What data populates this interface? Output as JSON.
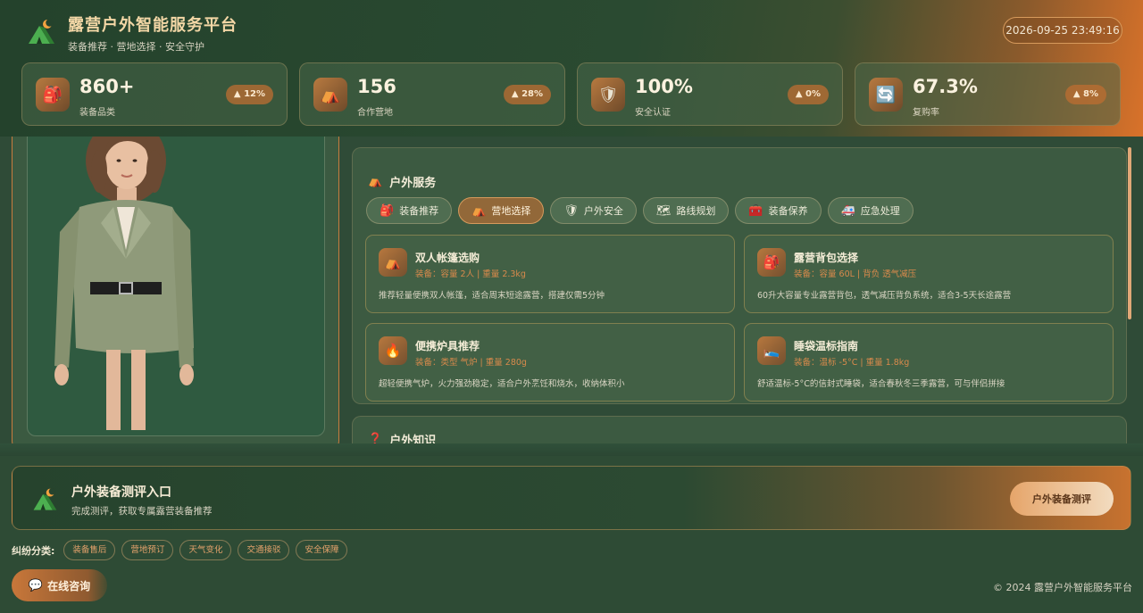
{
  "header": {
    "title": "露营户外智能服务平台",
    "subtitle": "装备推荐 · 营地选择 · 安全守护",
    "datetime": "2026-09-25 23:49:16"
  },
  "stats": [
    {
      "icon": "backpack-icon",
      "glyph": "🎒",
      "value": "860+",
      "label": "装备品类",
      "badge": "▲ 12%"
    },
    {
      "icon": "tent-icon",
      "glyph": "⛺",
      "value": "156",
      "label": "合作营地",
      "badge": "▲ 28%"
    },
    {
      "icon": "shield-icon",
      "glyph": "🛡",
      "value": "100%",
      "label": "安全认证",
      "badge": "▲ 0%"
    },
    {
      "icon": "refresh-icon",
      "glyph": "🔄",
      "value": "67.3%",
      "label": "复购率",
      "badge": "▲ 8%"
    }
  ],
  "services": {
    "title": "户外服务",
    "tabs": [
      {
        "label": "装备推荐",
        "glyph": "🎒",
        "active": false
      },
      {
        "label": "营地选择",
        "glyph": "⛺",
        "active": true
      },
      {
        "label": "户外安全",
        "glyph": "🛡",
        "active": false
      },
      {
        "label": "路线规划",
        "glyph": "🗺",
        "active": false
      },
      {
        "label": "装备保养",
        "glyph": "🧰",
        "active": false
      },
      {
        "label": "应急处理",
        "glyph": "🚑",
        "active": false
      }
    ],
    "cards": [
      {
        "icon": "tent-icon",
        "glyph": "⛺",
        "title": "双人帐篷选购",
        "meta": "装备：容量 2人 | 重量 2.3kg",
        "desc": "推荐轻量便携双人帐篷，适合周末短途露营，搭建仅需5分钟"
      },
      {
        "icon": "backpack-icon",
        "glyph": "🎒",
        "title": "露营背包选择",
        "meta": "装备：容量 60L | 背负 透气减压",
        "desc": "60升大容量专业露营背包，透气减压背负系统，适合3-5天长途露营"
      },
      {
        "icon": "fire-icon",
        "glyph": "🔥",
        "title": "便携炉具推荐",
        "meta": "装备：类型 气炉 | 重量 280g",
        "desc": "超轻便携气炉，火力强劲稳定，适合户外烹饪和烧水，收纳体积小"
      },
      {
        "icon": "sleeping-bag-icon",
        "glyph": "🛌",
        "title": "睡袋温标指南",
        "meta": "装备：温标 -5°C | 重量 1.8kg",
        "desc": "舒适温标-5°C的信封式睡袋，适合春秋冬三季露营，可与伴侣拼接"
      }
    ]
  },
  "knowledge": {
    "title": "户外知识",
    "glyph": "❓"
  },
  "evaluation": {
    "title": "户外装备测评入口",
    "subtitle": "完成测评，获取专属露营装备推荐",
    "button": "户外装备测评"
  },
  "categories": {
    "label": "纠纷分类:",
    "tags": [
      "装备售后",
      "营地预订",
      "天气变化",
      "交通接驳",
      "安全保障"
    ]
  },
  "consult": {
    "label": "在线咨询",
    "glyph": "💬"
  },
  "footer": {
    "copyright": "© 2024 露营户外智能服务平台"
  },
  "colors": {
    "accent": "#d9722a",
    "panel": "#3b5a41",
    "background": "#2f4b37"
  }
}
